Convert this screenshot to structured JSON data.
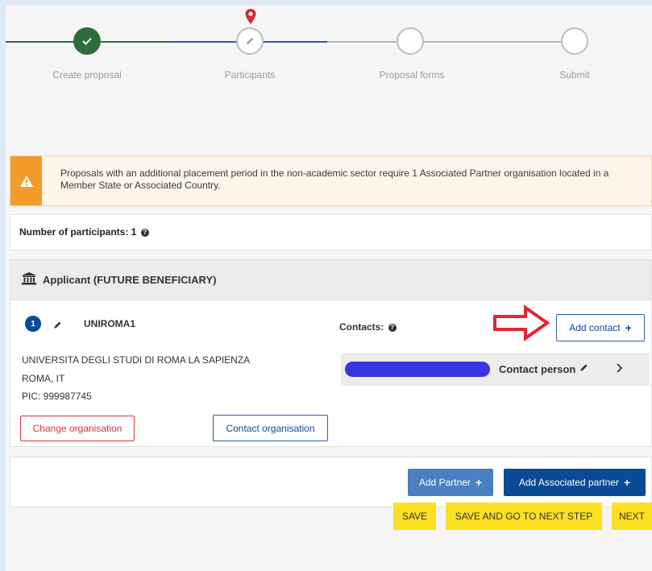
{
  "stepper": {
    "steps": [
      {
        "label": "Create proposal"
      },
      {
        "label": "Participants"
      },
      {
        "label": "Proposal forms"
      },
      {
        "label": "Submit"
      }
    ]
  },
  "alert": {
    "text": "Proposals with an additional placement period in the non-academic sector require 1 Associated Partner organisation located in a Member State or Associated Country."
  },
  "participants": {
    "count_label": "Number of participants: 1"
  },
  "applicant": {
    "title": "Applicant (FUTURE BENEFICIARY)",
    "number": "1",
    "short_name": "UNIROMA1",
    "org_name": "UNIVERSITA DEGLI STUDI DI ROMA LA SAPIENZA",
    "location": "ROMA, IT",
    "pic": "PIC: 999987745",
    "change_org_label": "Change organisation",
    "contact_org_label": "Contact organisation",
    "contacts_label": "Contacts:",
    "add_contact_label": "Add contact",
    "contact_person_label": "Contact person"
  },
  "actions": {
    "add_partner_label": "Add Partner",
    "add_associated_partner_label": "Add Associated partner",
    "save_label": "SAVE",
    "save_next_label": "SAVE AND GO TO NEXT STEP",
    "next_label": "NEXT"
  },
  "colors": {
    "step_done": "#2e6b3a",
    "step_active_line": "#2f5da8",
    "primary_blue": "#0b4a94",
    "muted_blue": "#4a7fc1",
    "warning_orange": "#f39b2b",
    "danger_red": "#d9363e",
    "action_yellow": "#fde024"
  }
}
